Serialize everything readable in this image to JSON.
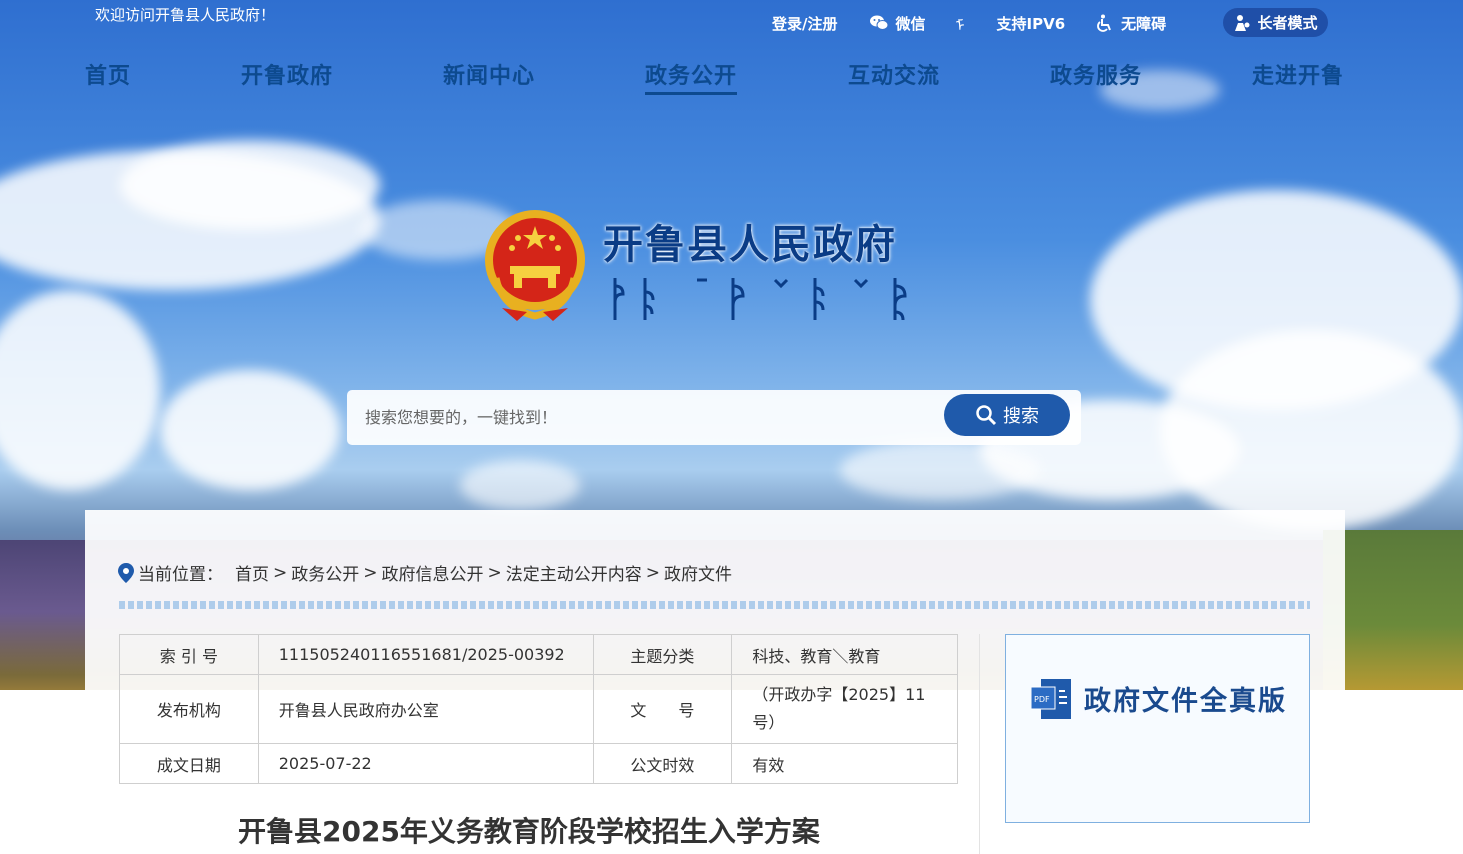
{
  "topbar": {
    "welcome": "欢迎访问开鲁县人民政府！",
    "links": {
      "login": "登录/注册",
      "wechat": "微信",
      "mongol_char": "ᠮ",
      "ipv6": "支持IPV6",
      "accessibility": "无障碍",
      "elder_mode": "长者模式"
    }
  },
  "nav": {
    "items": [
      "首页",
      "开鲁政府",
      "新闻中心",
      "政务公开",
      "互动交流",
      "政务服务",
      "走进开鲁"
    ],
    "active": "政务公开"
  },
  "header": {
    "site_title": "开鲁县人民政府"
  },
  "search": {
    "placeholder": "搜索您想要的，一键找到！",
    "button_label": "搜索"
  },
  "breadcrumb": {
    "prefix": "当前位置：",
    "items": [
      "首页",
      "政务公开",
      "政府信息公开",
      "法定主动公开内容",
      "政府文件"
    ],
    "separator": ">"
  },
  "meta_table": {
    "index_label": "索 引 号",
    "index_value": "111505240116551681/2025-00392",
    "topic_label": "主题分类",
    "topic_value": "科技、教育＼教育",
    "publisher_label": "发布机构",
    "publisher_value": "开鲁县人民政府办公室",
    "docno_label": "文　　号",
    "docno_value": "（开政办字【2025】11号）",
    "date_label": "成文日期",
    "date_value": "2025-07-22",
    "validity_label": "公文时效",
    "validity_value": "有效"
  },
  "full_version": {
    "label": "政府文件全真版"
  },
  "document": {
    "title": "开鲁县2025年义务教育阶段学校招生入学方案"
  },
  "colors": {
    "nav_text": "#0d4a8f",
    "accent_blue": "#1f5aab",
    "elder_bg": "#1f4fa8"
  }
}
